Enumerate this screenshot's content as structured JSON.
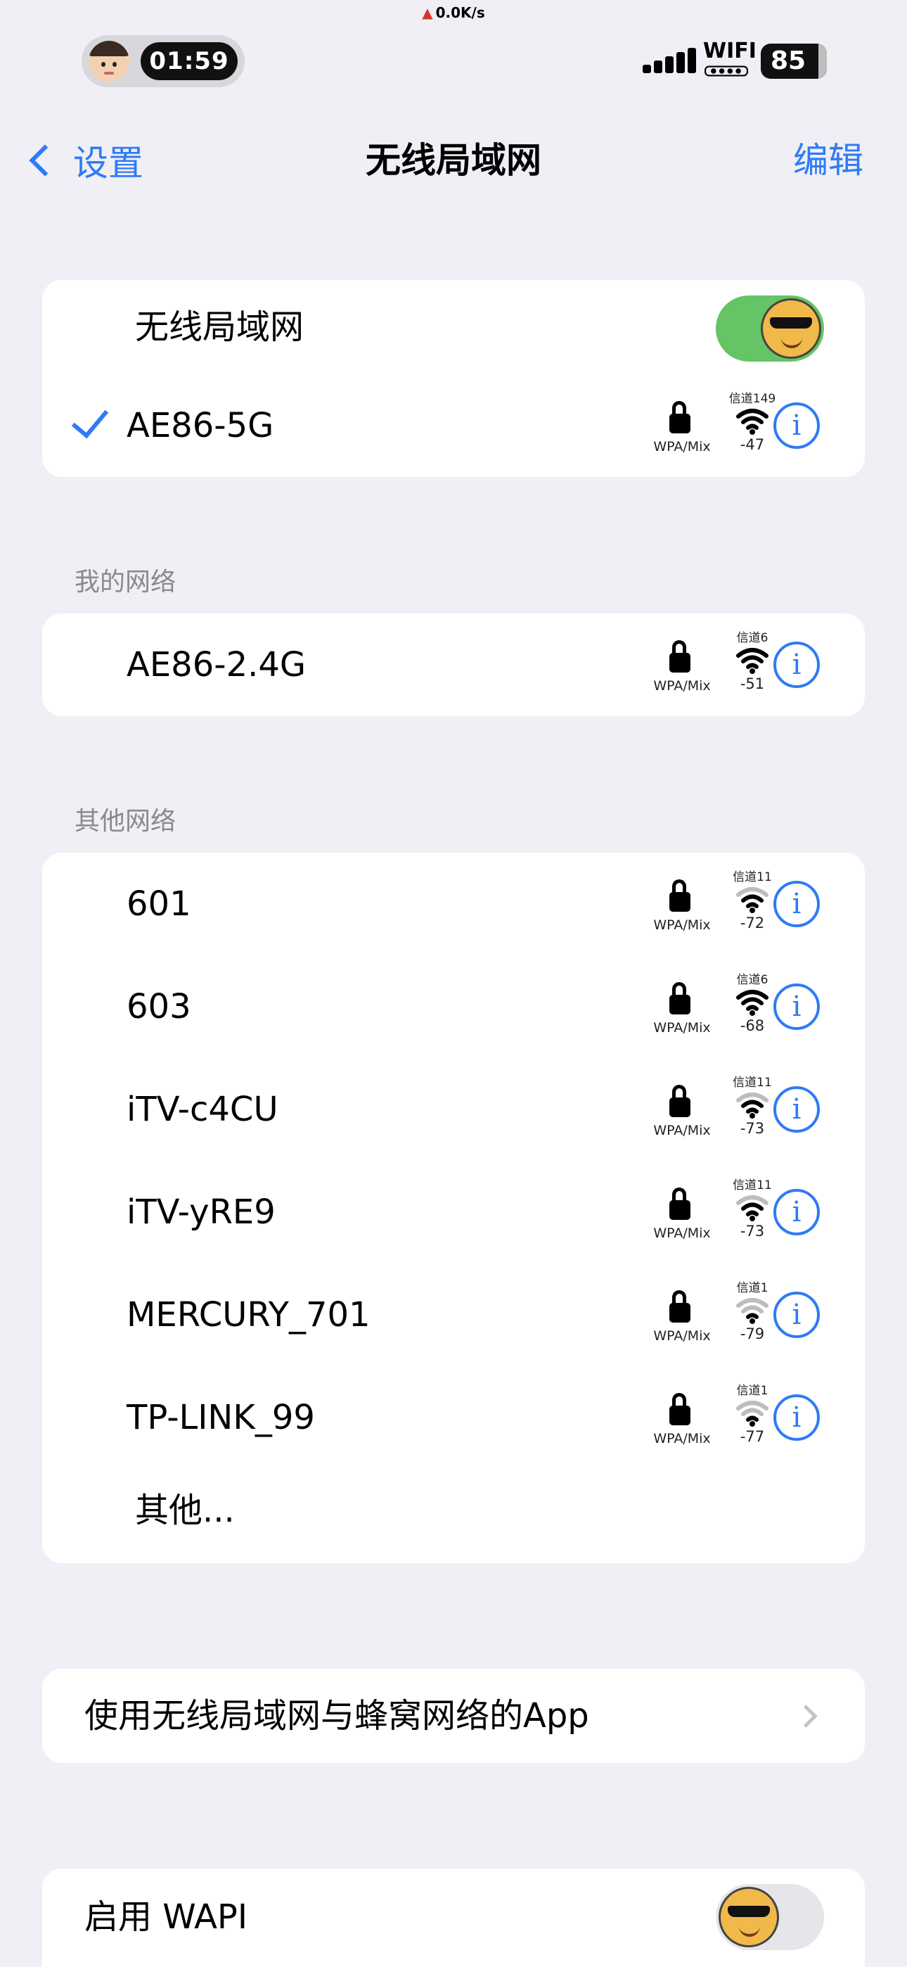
{
  "status_bar": {
    "net_speed": "0.0K/s",
    "time": "01:59",
    "wifi_label": "WIFI",
    "battery": "85"
  },
  "nav": {
    "back_label": "设置",
    "title": "无线局域网",
    "edit_label": "编辑"
  },
  "wifi_toggle": {
    "label": "无线局域网",
    "on": true
  },
  "connected": {
    "ssid": "AE86-5G",
    "security": "WPA/Mix",
    "channel": "信道149",
    "rssi": "-47"
  },
  "my_networks": {
    "header": "我的网络",
    "items": [
      {
        "ssid": "AE86-2.4G",
        "security": "WPA/Mix",
        "channel": "信道6",
        "rssi": "-51"
      }
    ]
  },
  "other_networks": {
    "header": "其他网络",
    "items": [
      {
        "ssid": "601",
        "security": "WPA/Mix",
        "channel": "信道11",
        "rssi": "-72"
      },
      {
        "ssid": "603",
        "security": "WPA/Mix",
        "channel": "信道6",
        "rssi": "-68"
      },
      {
        "ssid": "iTV-c4CU",
        "security": "WPA/Mix",
        "channel": "信道11",
        "rssi": "-73"
      },
      {
        "ssid": "iTV-yRE9",
        "security": "WPA/Mix",
        "channel": "信道11",
        "rssi": "-73"
      },
      {
        "ssid": "MERCURY_701",
        "security": "WPA/Mix",
        "channel": "信道1",
        "rssi": "-79"
      },
      {
        "ssid": "TP-LINK_99",
        "security": "WPA/Mix",
        "channel": "信道1",
        "rssi": "-77"
      }
    ],
    "other_label": "其他..."
  },
  "apps_row": {
    "label": "使用无线局域网与蜂窝网络的App"
  },
  "wapi_toggle": {
    "label": "启用 WAPI",
    "on": false
  },
  "colors": {
    "accent": "#2f7bf5",
    "toggle_on": "#65c466",
    "background": "#f0eff5"
  },
  "icons": [
    "car-icon",
    "memoji-avatar",
    "cellular-signal-icon",
    "battery-icon",
    "chevron-left-icon",
    "checkmark-icon",
    "lock-icon",
    "wifi-signal-icon",
    "info-icon",
    "chevron-right-icon",
    "sunglasses-emoji-icon"
  ]
}
